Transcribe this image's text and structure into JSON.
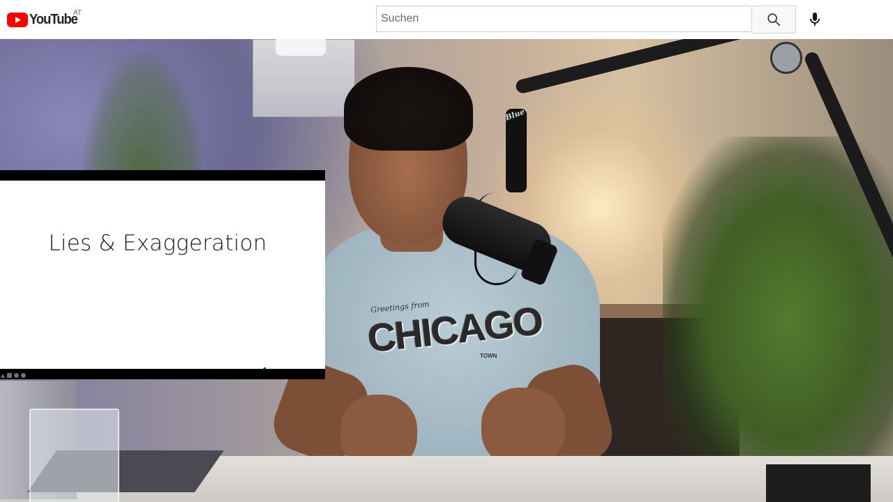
{
  "masthead": {
    "logo_text": "YouTube",
    "country_code": "AT",
    "search": {
      "placeholder": "Suchen",
      "value": ""
    },
    "icons": {
      "logo": "youtube-logo-icon",
      "search": "search-icon",
      "mic": "microphone-icon"
    },
    "colors": {
      "brand_red": "#FF0000"
    }
  },
  "video": {
    "slide": {
      "title": "Lies & Exaggeration",
      "toolbar_icons": [
        "triangle-icon",
        "grid-icon",
        "zoom-icon",
        "settings-icon"
      ]
    },
    "shirt_print": {
      "script": "Greetings from",
      "main": "CHICAGO",
      "sub": "TOWN"
    },
    "mic_badge": "Blue"
  }
}
